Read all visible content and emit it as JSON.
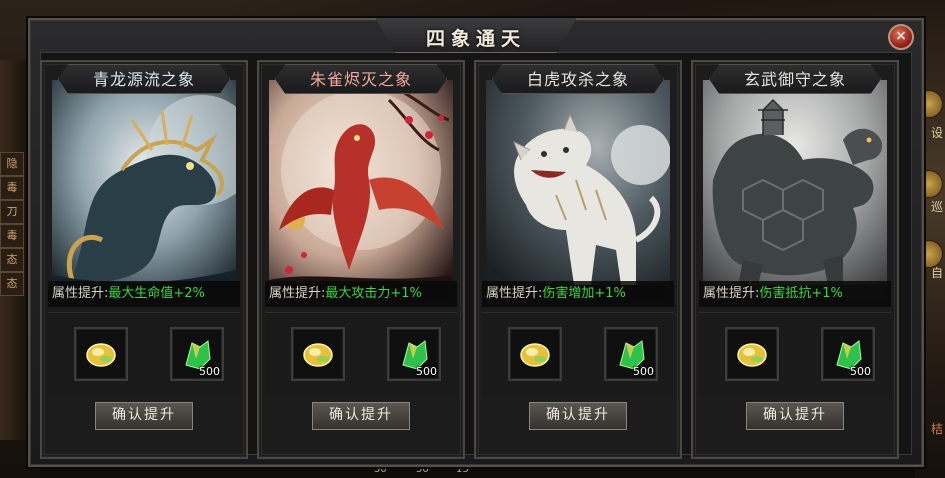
{
  "window": {
    "title": "四象通天",
    "close_label": "×"
  },
  "cards": [
    {
      "title": "青龙源流之象",
      "title_color": "#e8e4da",
      "attr_label": "属性提升:",
      "attr_value": "最大生命值+2%",
      "slot1_icon": "gold-gem-icon",
      "slot2_icon": "green-shard-icon",
      "slot2_qty": "500",
      "button_label": "确认提升",
      "art": "azure-dragon-illustration"
    },
    {
      "title": "朱雀烬灭之象",
      "title_color": "#f0a090",
      "attr_label": "属性提升:",
      "attr_value": "最大攻击力+1%",
      "slot1_icon": "gold-gem-icon",
      "slot2_icon": "green-shard-icon",
      "slot2_qty": "500",
      "button_label": "确认提升",
      "art": "vermilion-bird-illustration"
    },
    {
      "title": "白虎攻杀之象",
      "title_color": "#e8e4da",
      "attr_label": "属性提升:",
      "attr_value": "伤害增加+1%",
      "slot1_icon": "gold-gem-icon",
      "slot2_icon": "green-shard-icon",
      "slot2_qty": "500",
      "button_label": "确认提升",
      "art": "white-tiger-illustration"
    },
    {
      "title": "玄武御守之象",
      "title_color": "#e8e4da",
      "attr_label": "属性提升:",
      "attr_value": "伤害抵抗+1%",
      "slot1_icon": "gold-gem-icon",
      "slot2_icon": "green-shard-icon",
      "slot2_qty": "500",
      "button_label": "确认提升",
      "art": "black-tortoise-illustration"
    }
  ],
  "background": {
    "left_tags": [
      "隐",
      "毒",
      "刀",
      "毒",
      "态",
      "态"
    ],
    "right_labels": [
      "设",
      "巡",
      "自",
      "桔"
    ],
    "bottom_numbers": [
      "50",
      "50",
      "13"
    ]
  },
  "colors": {
    "attr_value": "#3ad83a",
    "close_button": "#b0281e"
  }
}
